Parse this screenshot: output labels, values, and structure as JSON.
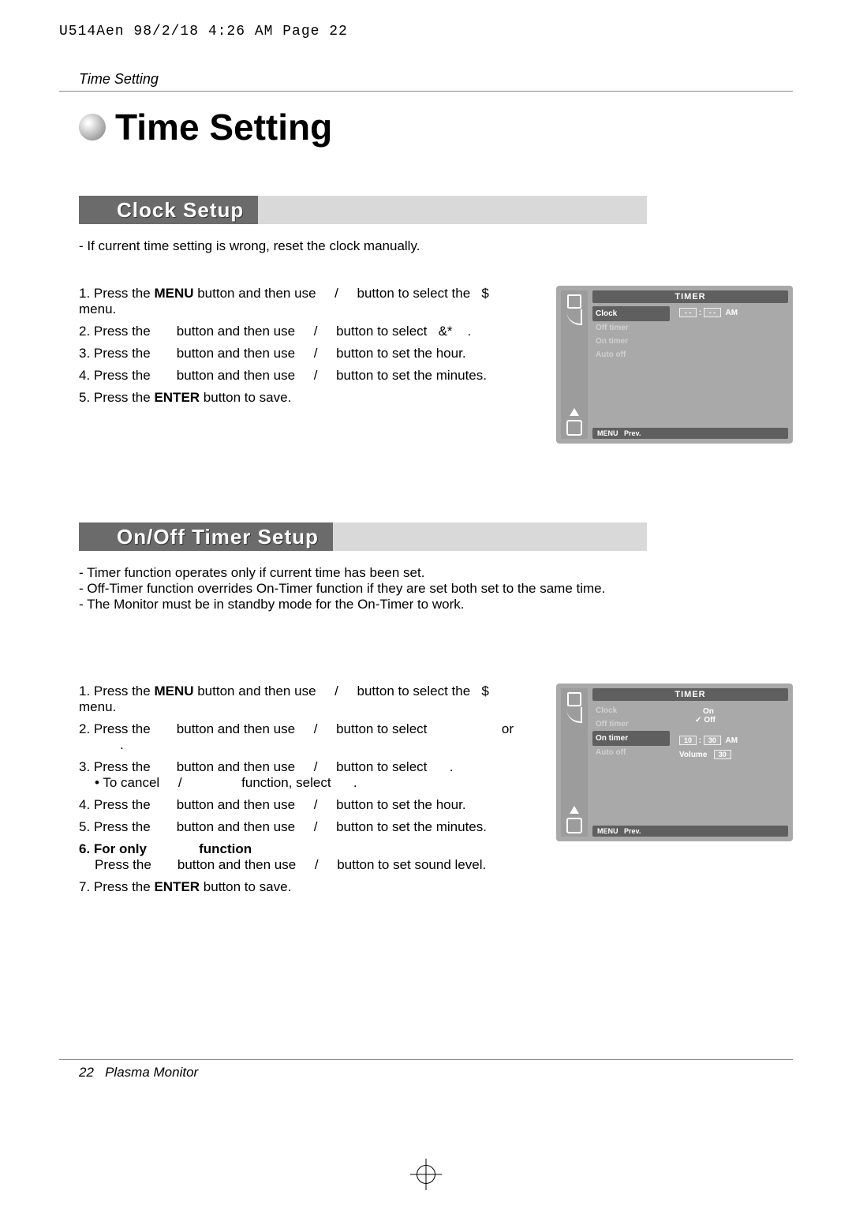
{
  "print_header": "U514Aen  98/2/18 4:26 AM  Page 22",
  "running_title": "Time Setting",
  "main_title": "Time Setting",
  "section_clock": {
    "title": "Clock Setup",
    "intro": [
      "If current time setting is wrong, reset the clock manually."
    ],
    "steps": {
      "s1_a": "1. Press the ",
      "s1_b": "MENU",
      "s1_c": " button and then use ",
      "s1_slash": "/",
      "s1_d": " button to select the ",
      "s1_sym": "$",
      "s1_e": " menu.",
      "s2_a": "2. Press the ",
      "s2_b": " button and then use ",
      "s2_slash": "/",
      "s2_c": " button to select ",
      "s2_sym": "&*",
      "s2_d": ".",
      "s3_a": "3. Press the ",
      "s3_b": " button and then use ",
      "s3_slash": "/",
      "s3_c": " button to set the hour.",
      "s4_a": "4. Press the ",
      "s4_b": " button and then use ",
      "s4_slash": "/",
      "s4_c": " button to set the minutes.",
      "s5_a": "5. Press the ",
      "s5_b": "ENTER",
      "s5_c": " button to save."
    }
  },
  "section_timer": {
    "title": "On/Off Timer Setup",
    "intro": [
      "Timer function operates only if current time has been set.",
      "Off-Timer function overrides On-Timer function if they are set both set to the same time.",
      "The Monitor must be in standby mode for the On-Timer to work."
    ],
    "steps": {
      "s1_a": "1. Press the ",
      "s1_b": "MENU",
      "s1_c": " button and then use ",
      "s1_slash": "/",
      "s1_d": " button to select the ",
      "s1_sym": "$",
      "s1_e": " menu.",
      "s2_a": "2. Press the ",
      "s2_b": " button and then use ",
      "s2_slash": "/",
      "s2_c": " button to select ",
      "s2_or": " or ",
      "s2_d": ".",
      "s3_a": "3. Press the ",
      "s3_b": " button and then use ",
      "s3_slash": "/",
      "s3_c": " button to select ",
      "s3_d": ".",
      "s3x_a": "• To cancel ",
      "s3x_slash": "/",
      "s3x_b": " function, select ",
      "s3x_c": ".",
      "s4_a": "4. Press the ",
      "s4_b": " button and then use ",
      "s4_slash": "/",
      "s4_c": " button to set the hour.",
      "s5_a": "5. Press the ",
      "s5_b": " button and then use ",
      "s5_slash": "/",
      "s5_c": " button to set the minutes.",
      "s6_a": "6. For only ",
      "s6_b": " function",
      "s6x_a": "Press the ",
      "s6x_b": " button and then use ",
      "s6x_slash": "/",
      "s6x_c": " button to set sound level.",
      "s7_a": "7. Press the ",
      "s7_b": "ENTER",
      "s7_c": " button to save."
    }
  },
  "osd1": {
    "header": "TIMER",
    "menu": {
      "sel": "Clock",
      "items": [
        "Off timer",
        "On timer",
        "Auto off"
      ]
    },
    "right": {
      "hh": "- -",
      "sep": ":",
      "mm": "- -",
      "ampm": "AM"
    },
    "footer": {
      "menu": "MENU",
      "prev": "Prev."
    }
  },
  "osd2": {
    "header": "TIMER",
    "menu": {
      "items_top": [
        "Clock",
        "Off timer"
      ],
      "sel": "On timer",
      "items_bot": [
        "Auto off"
      ]
    },
    "right": {
      "on": "On",
      "off": "Off",
      "hh": "10",
      "sep": ":",
      "mm": "30",
      "ampm": "AM",
      "vol_label": "Volume",
      "vol_val": "30"
    },
    "footer": {
      "menu": "MENU",
      "prev": "Prev."
    }
  },
  "footer": {
    "page": "22",
    "label": "Plasma Monitor"
  }
}
